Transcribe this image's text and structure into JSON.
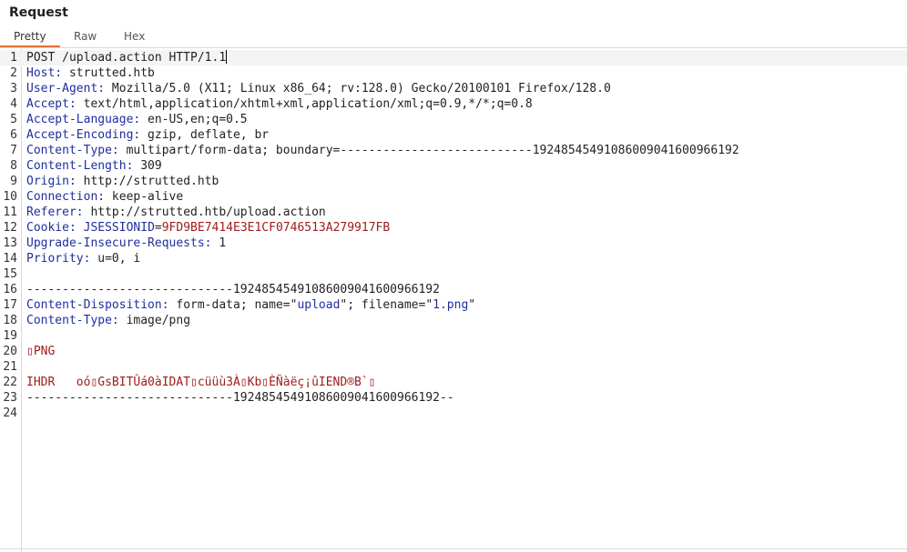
{
  "panel": {
    "title": "Request"
  },
  "tabs": [
    {
      "label": "Pretty"
    },
    {
      "label": "Raw"
    },
    {
      "label": "Hex"
    }
  ],
  "lines": [
    {
      "n": "1",
      "parts": [
        {
          "t": "POST /upload.action HTTP/1.1",
          "c": "v"
        }
      ],
      "cursor": true
    },
    {
      "n": "2",
      "parts": [
        {
          "t": "Host:",
          "c": "k"
        },
        {
          "t": " strutted.htb",
          "c": "v"
        }
      ]
    },
    {
      "n": "3",
      "parts": [
        {
          "t": "User-Agent:",
          "c": "k"
        },
        {
          "t": " Mozilla/5.0 (X11; Linux x86_64; rv:128.0) Gecko/20100101 Firefox/128.0",
          "c": "v"
        }
      ]
    },
    {
      "n": "4",
      "parts": [
        {
          "t": "Accept:",
          "c": "k"
        },
        {
          "t": " text/html,application/xhtml+xml,application/xml;q=0.9,*/*;q=0.8",
          "c": "v"
        }
      ]
    },
    {
      "n": "5",
      "parts": [
        {
          "t": "Accept-Language:",
          "c": "k"
        },
        {
          "t": " en-US,en;q=0.5",
          "c": "v"
        }
      ]
    },
    {
      "n": "6",
      "parts": [
        {
          "t": "Accept-Encoding:",
          "c": "k"
        },
        {
          "t": " gzip, deflate, br",
          "c": "v"
        }
      ]
    },
    {
      "n": "7",
      "parts": [
        {
          "t": "Content-Type:",
          "c": "k"
        },
        {
          "t": " multipart/form-data; boundary=---------------------------192485454910860090416009661​92",
          "c": "v"
        }
      ]
    },
    {
      "n": "8",
      "parts": [
        {
          "t": "Content-Length:",
          "c": "k"
        },
        {
          "t": " 309",
          "c": "v"
        }
      ]
    },
    {
      "n": "9",
      "parts": [
        {
          "t": "Origin:",
          "c": "k"
        },
        {
          "t": " http://strutted.htb",
          "c": "v"
        }
      ]
    },
    {
      "n": "10",
      "parts": [
        {
          "t": "Connection:",
          "c": "k"
        },
        {
          "t": " keep-alive",
          "c": "v"
        }
      ]
    },
    {
      "n": "11",
      "parts": [
        {
          "t": "Referer:",
          "c": "k"
        },
        {
          "t": " http://strutted.htb/upload.action",
          "c": "v"
        }
      ]
    },
    {
      "n": "12",
      "parts": [
        {
          "t": "Cookie:",
          "c": "k"
        },
        {
          "t": " ",
          "c": "v"
        },
        {
          "t": "JSESSIONID",
          "c": "s"
        },
        {
          "t": "=",
          "c": "v"
        },
        {
          "t": "9FD9BE7414E3E1CF0746513A279917FB",
          "c": "r"
        }
      ]
    },
    {
      "n": "13",
      "parts": [
        {
          "t": "Upgrade-Insecure-Requests:",
          "c": "k"
        },
        {
          "t": " 1",
          "c": "v"
        }
      ]
    },
    {
      "n": "14",
      "parts": [
        {
          "t": "Priority:",
          "c": "k"
        },
        {
          "t": " u=0, i",
          "c": "v"
        }
      ]
    },
    {
      "n": "15",
      "parts": []
    },
    {
      "n": "16",
      "parts": [
        {
          "t": "-----------------------------19248545491086009041600966192",
          "c": "v"
        }
      ]
    },
    {
      "n": "17",
      "parts": [
        {
          "t": "Content-Disposition:",
          "c": "k"
        },
        {
          "t": " form-data; name=\"",
          "c": "v"
        },
        {
          "t": "upload",
          "c": "s"
        },
        {
          "t": "\"; filename=\"",
          "c": "v"
        },
        {
          "t": "1.png",
          "c": "s"
        },
        {
          "t": "\"",
          "c": "v"
        }
      ]
    },
    {
      "n": "18",
      "parts": [
        {
          "t": "Content-Type:",
          "c": "k"
        },
        {
          "t": " image/png",
          "c": "v"
        }
      ]
    },
    {
      "n": "19",
      "parts": []
    },
    {
      "n": "20",
      "parts": [
        {
          "t": "▯PNG",
          "c": "r"
        }
      ]
    },
    {
      "n": "21",
      "parts": []
    },
    {
      "n": "22",
      "parts": [
        {
          "t": "IHDR   oó▯GsBITÛá0àIDAT▯cüüù3À▯Kb▯ÈÑàëç¡ûIEND®B`▯",
          "c": "r"
        }
      ]
    },
    {
      "n": "23",
      "parts": [
        {
          "t": "-----------------------------19248545491086009041600966192--",
          "c": "v"
        }
      ]
    },
    {
      "n": "24",
      "parts": []
    }
  ]
}
